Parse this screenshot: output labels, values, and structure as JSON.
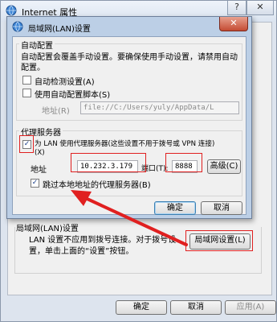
{
  "outer_window": {
    "title": "Internet 属性",
    "help_button": "?",
    "close_button": "✕",
    "lan_group_label": "局域网(LAN)设置",
    "lan_description": "LAN 设置不应用到拨号连接。对于拨号设置，单击上面的“设置”按钮。",
    "lan_settings_button": "局域网设置(L)",
    "ok_button": "确定",
    "cancel_button": "取消",
    "apply_button": "应用(A)"
  },
  "lan_dialog": {
    "title": "局域网(LAN)设置",
    "close_button": "✕",
    "auto_config": {
      "group_label": "自动配置",
      "description_line1": "自动配置会覆盖手动设置。要确保使用手动设置，请禁用自动",
      "description_line2": "配置。",
      "auto_detect_label": "自动检测设置(A)",
      "auto_detect_checked": false,
      "use_script_label": "使用自动配置脚本(S)",
      "use_script_checked": false,
      "address_label": "地址(R)",
      "address_value": "file://C:/Users/yuly/AppData/L"
    },
    "proxy": {
      "group_label": "代理服务器",
      "use_proxy_line1": "为 LAN 使用代理服务器(这些设置不用于拨号或 VPN 连接)",
      "use_proxy_line2": "(X)",
      "use_proxy_checked": true,
      "address_label": "地址",
      "address_value": "10.232.3.179",
      "port_label": "端口(T):",
      "port_value": "8888",
      "advanced_button": "高级(C)",
      "bypass_local_label": "跳过本地地址的代理服务器(B)",
      "bypass_local_checked": true
    },
    "ok_button": "确定",
    "cancel_button": "取消"
  },
  "colors": {
    "annotation_red": "#e02020",
    "dialog_frame": "#bccfe6"
  }
}
